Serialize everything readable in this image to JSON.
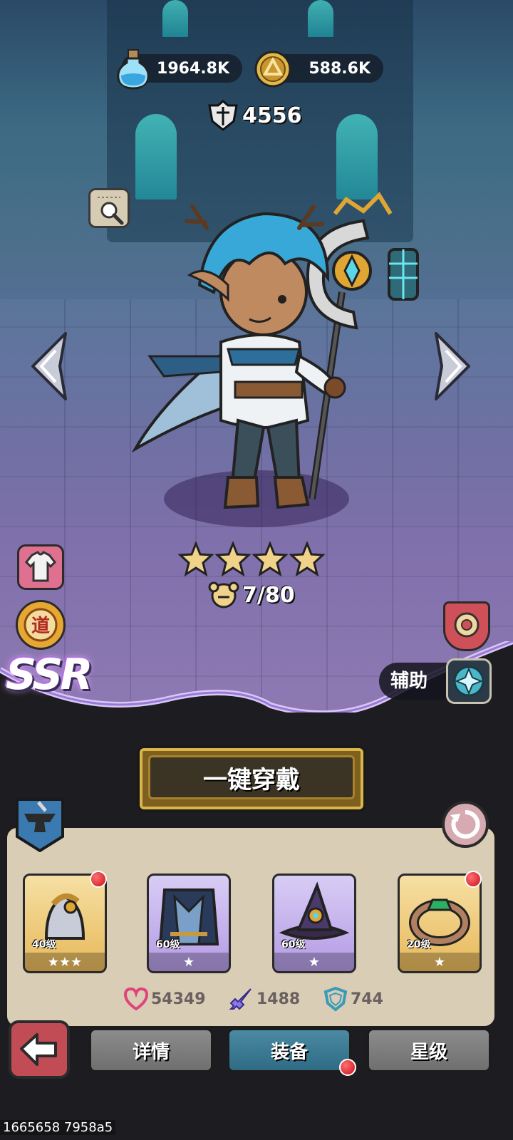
{
  "resources": {
    "potion": {
      "value": "1964.8K",
      "icon": "potion-flask-icon"
    },
    "coin": {
      "value": "588.6K",
      "icon": "gold-coin-icon"
    }
  },
  "power": {
    "value": "4556",
    "icon": "combat-power-icon"
  },
  "hero": {
    "stars": 4,
    "fragments": "7/80",
    "rarity": "SSR",
    "role": "辅助"
  },
  "equip_all_label": "一键穿戴",
  "equipment": [
    {
      "level": "40级",
      "stars": 3,
      "frame": "gold",
      "red_dot": true,
      "icon": "bell-helmet-icon"
    },
    {
      "level": "60级",
      "stars": 1,
      "frame": "purple",
      "red_dot": false,
      "icon": "cloak-armor-icon"
    },
    {
      "level": "60级",
      "stars": 1,
      "frame": "purple",
      "red_dot": false,
      "icon": "wizard-hat-icon"
    },
    {
      "level": "20级",
      "stars": 1,
      "frame": "gold",
      "red_dot": true,
      "icon": "ring-icon"
    }
  ],
  "stats": {
    "hp": {
      "value": "54349",
      "icon": "heart-icon",
      "color": "#e0447a"
    },
    "atk": {
      "value": "1488",
      "icon": "sword-icon",
      "color": "#6a5ad8"
    },
    "def": {
      "value": "744",
      "icon": "shield-icon",
      "color": "#3a9ab8"
    }
  },
  "tabs": [
    {
      "label": "详情",
      "active": false
    },
    {
      "label": "装备",
      "active": true
    },
    {
      "label": "星级",
      "active": false
    }
  ],
  "footer_id": "1665658 7958a5"
}
